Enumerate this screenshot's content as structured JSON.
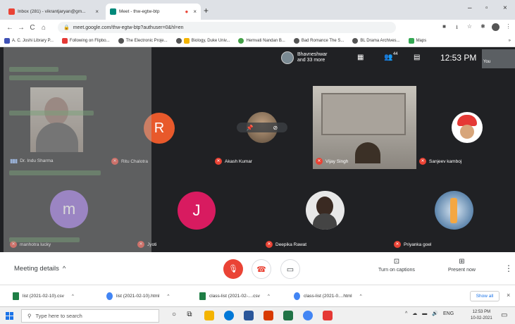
{
  "browser": {
    "tabs": [
      {
        "title": "Inbox (281) - vikrantjaryan@gm...",
        "close": "×"
      },
      {
        "title": "Meet - thw-egtw-btp",
        "close": "×"
      }
    ],
    "new_tab": "+",
    "window_controls": [
      "–",
      "▫",
      "×"
    ],
    "url": "meet.google.com/thw-egtw-btp?authuser=0&hl=en"
  },
  "bookmarks": [
    "A. C. Joshi Library P...",
    "Following on Flipbo...",
    "The Electronic Proje...",
    "Biology, Duke Univ...",
    "Hemvati Nandan B...",
    "Bad Romance The S...",
    "BL Drama Archives...",
    "Maps"
  ],
  "meet": {
    "presenter": {
      "name": "Bhavneshwar",
      "more": "and 33 more"
    },
    "people_count": "44",
    "time": "12:53 PM",
    "self_label": "You",
    "participants": [
      {
        "name": "Dr. Indu Sharma",
        "state": "talking"
      },
      {
        "name": "Ritu Chalotra",
        "state": "muted",
        "initial": "R"
      },
      {
        "name": "Akash Kumar",
        "state": "muted"
      },
      {
        "name": "Vijay Singh",
        "state": "muted"
      },
      {
        "name": "Sanjeev kamboj",
        "state": "muted"
      },
      {
        "name": "manhotra lucky",
        "state": "muted",
        "initial": "m"
      },
      {
        "name": "Jyoti",
        "state": "muted",
        "initial": "J"
      },
      {
        "name": "Deepika Rawat",
        "state": "muted"
      },
      {
        "name": "Priyanka goel",
        "state": "muted"
      }
    ],
    "colors": {
      "ritu": "#e8592b",
      "manhotra": "#8e67d8",
      "jyoti": "#d81b60",
      "mute_red": "#ea4335"
    }
  },
  "controls": {
    "meeting_details": "Meeting details",
    "captions": "Turn on captions",
    "present": "Present now"
  },
  "downloads": [
    "list (2021-02-10).csv",
    "list (2021-02-10).html",
    "class-list (2021-02-....csv",
    "class-list (2021-0....html"
  ],
  "downloads_show_all": "Show all",
  "taskbar": {
    "search_placeholder": "Type here to search",
    "lang": "ENG",
    "time": "12:53 PM",
    "date": "10-02-2021"
  }
}
